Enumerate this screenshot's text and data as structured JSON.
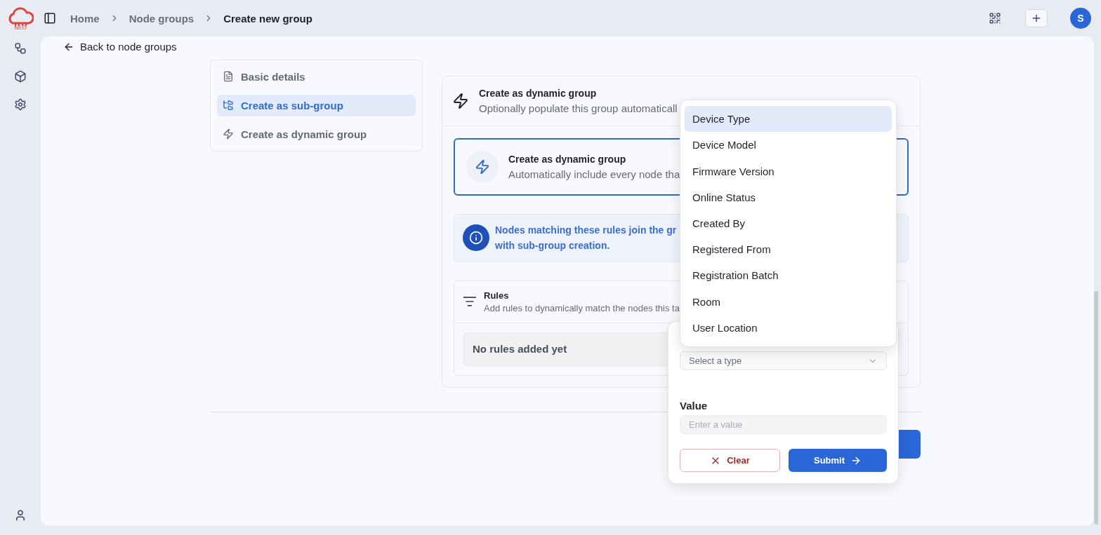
{
  "topbar": {
    "logo_caption": "NEO",
    "breadcrumbs": [
      {
        "label": "Home",
        "current": false
      },
      {
        "label": "Node groups",
        "current": false
      },
      {
        "label": "Create new group",
        "current": true
      }
    ],
    "avatar": "S"
  },
  "back_link": "Back to node groups",
  "steps": [
    {
      "label": "Basic details",
      "kind": "document",
      "selected": false
    },
    {
      "label": "Create as sub-group",
      "kind": "tree",
      "selected": true
    },
    {
      "label": "Create as dynamic group",
      "kind": "bolt",
      "selected": false
    }
  ],
  "section": {
    "title": "Create as dynamic group",
    "subtitle": "Optionally populate this group automaticall"
  },
  "option": {
    "title": "Create as dynamic group",
    "subtitle": "Automatically include every node tha",
    "selected": true
  },
  "info": {
    "lines": [
      "Nodes matching these rules join the gr",
      "with sub-group creation."
    ]
  },
  "rules": {
    "title": "Rules",
    "subtitle": "Add rules to dynamically match the nodes this ta",
    "empty": "No rules added yet"
  },
  "rule_popover": {
    "type_placeholder": "Select a type",
    "value_label": "Value",
    "value_placeholder": "Enter a value",
    "clear": "Clear",
    "submit": "Submit"
  },
  "type_dropdown": {
    "options": [
      {
        "label": "Device Type",
        "selected": true
      },
      {
        "label": "Device Model",
        "selected": false
      },
      {
        "label": "Firmware Version",
        "selected": false
      },
      {
        "label": "Online Status",
        "selected": false
      },
      {
        "label": "Created By",
        "selected": false
      },
      {
        "label": "Registered From",
        "selected": false
      },
      {
        "label": "Registration Batch",
        "selected": false
      },
      {
        "label": "Room",
        "selected": false
      },
      {
        "label": "User Location",
        "selected": false
      }
    ]
  }
}
